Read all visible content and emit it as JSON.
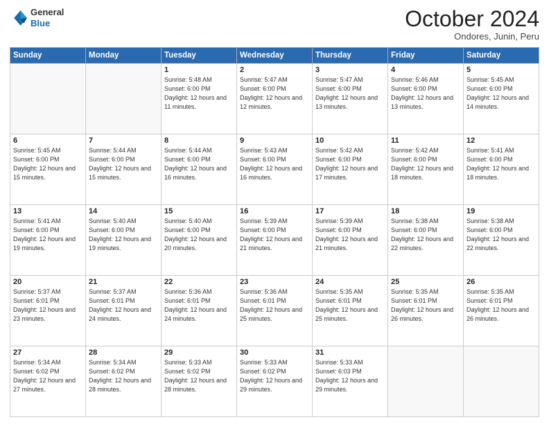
{
  "header": {
    "logo_general": "General",
    "logo_blue": "Blue",
    "month_title": "October 2024",
    "location": "Ondores, Junin, Peru"
  },
  "calendar": {
    "days_of_week": [
      "Sunday",
      "Monday",
      "Tuesday",
      "Wednesday",
      "Thursday",
      "Friday",
      "Saturday"
    ],
    "weeks": [
      [
        {
          "day": "",
          "empty": true
        },
        {
          "day": "",
          "empty": true
        },
        {
          "day": "1",
          "sunrise": "5:48 AM",
          "sunset": "6:00 PM",
          "daylight": "12 hours and 11 minutes."
        },
        {
          "day": "2",
          "sunrise": "5:47 AM",
          "sunset": "6:00 PM",
          "daylight": "12 hours and 12 minutes."
        },
        {
          "day": "3",
          "sunrise": "5:47 AM",
          "sunset": "6:00 PM",
          "daylight": "12 hours and 13 minutes."
        },
        {
          "day": "4",
          "sunrise": "5:46 AM",
          "sunset": "6:00 PM",
          "daylight": "12 hours and 13 minutes."
        },
        {
          "day": "5",
          "sunrise": "5:45 AM",
          "sunset": "6:00 PM",
          "daylight": "12 hours and 14 minutes."
        }
      ],
      [
        {
          "day": "6",
          "sunrise": "5:45 AM",
          "sunset": "6:00 PM",
          "daylight": "12 hours and 15 minutes."
        },
        {
          "day": "7",
          "sunrise": "5:44 AM",
          "sunset": "6:00 PM",
          "daylight": "12 hours and 15 minutes."
        },
        {
          "day": "8",
          "sunrise": "5:44 AM",
          "sunset": "6:00 PM",
          "daylight": "12 hours and 16 minutes."
        },
        {
          "day": "9",
          "sunrise": "5:43 AM",
          "sunset": "6:00 PM",
          "daylight": "12 hours and 16 minutes."
        },
        {
          "day": "10",
          "sunrise": "5:42 AM",
          "sunset": "6:00 PM",
          "daylight": "12 hours and 17 minutes."
        },
        {
          "day": "11",
          "sunrise": "5:42 AM",
          "sunset": "6:00 PM",
          "daylight": "12 hours and 18 minutes."
        },
        {
          "day": "12",
          "sunrise": "5:41 AM",
          "sunset": "6:00 PM",
          "daylight": "12 hours and 18 minutes."
        }
      ],
      [
        {
          "day": "13",
          "sunrise": "5:41 AM",
          "sunset": "6:00 PM",
          "daylight": "12 hours and 19 minutes."
        },
        {
          "day": "14",
          "sunrise": "5:40 AM",
          "sunset": "6:00 PM",
          "daylight": "12 hours and 19 minutes."
        },
        {
          "day": "15",
          "sunrise": "5:40 AM",
          "sunset": "6:00 PM",
          "daylight": "12 hours and 20 minutes."
        },
        {
          "day": "16",
          "sunrise": "5:39 AM",
          "sunset": "6:00 PM",
          "daylight": "12 hours and 21 minutes."
        },
        {
          "day": "17",
          "sunrise": "5:39 AM",
          "sunset": "6:00 PM",
          "daylight": "12 hours and 21 minutes."
        },
        {
          "day": "18",
          "sunrise": "5:38 AM",
          "sunset": "6:00 PM",
          "daylight": "12 hours and 22 minutes."
        },
        {
          "day": "19",
          "sunrise": "5:38 AM",
          "sunset": "6:00 PM",
          "daylight": "12 hours and 22 minutes."
        }
      ],
      [
        {
          "day": "20",
          "sunrise": "5:37 AM",
          "sunset": "6:01 PM",
          "daylight": "12 hours and 23 minutes."
        },
        {
          "day": "21",
          "sunrise": "5:37 AM",
          "sunset": "6:01 PM",
          "daylight": "12 hours and 24 minutes."
        },
        {
          "day": "22",
          "sunrise": "5:36 AM",
          "sunset": "6:01 PM",
          "daylight": "12 hours and 24 minutes."
        },
        {
          "day": "23",
          "sunrise": "5:36 AM",
          "sunset": "6:01 PM",
          "daylight": "12 hours and 25 minutes."
        },
        {
          "day": "24",
          "sunrise": "5:35 AM",
          "sunset": "6:01 PM",
          "daylight": "12 hours and 25 minutes."
        },
        {
          "day": "25",
          "sunrise": "5:35 AM",
          "sunset": "6:01 PM",
          "daylight": "12 hours and 26 minutes."
        },
        {
          "day": "26",
          "sunrise": "5:35 AM",
          "sunset": "6:01 PM",
          "daylight": "12 hours and 26 minutes."
        }
      ],
      [
        {
          "day": "27",
          "sunrise": "5:34 AM",
          "sunset": "6:02 PM",
          "daylight": "12 hours and 27 minutes."
        },
        {
          "day": "28",
          "sunrise": "5:34 AM",
          "sunset": "6:02 PM",
          "daylight": "12 hours and 28 minutes."
        },
        {
          "day": "29",
          "sunrise": "5:33 AM",
          "sunset": "6:02 PM",
          "daylight": "12 hours and 28 minutes."
        },
        {
          "day": "30",
          "sunrise": "5:33 AM",
          "sunset": "6:02 PM",
          "daylight": "12 hours and 29 minutes."
        },
        {
          "day": "31",
          "sunrise": "5:33 AM",
          "sunset": "6:03 PM",
          "daylight": "12 hours and 29 minutes."
        },
        {
          "day": "",
          "empty": true
        },
        {
          "day": "",
          "empty": true
        }
      ]
    ]
  }
}
